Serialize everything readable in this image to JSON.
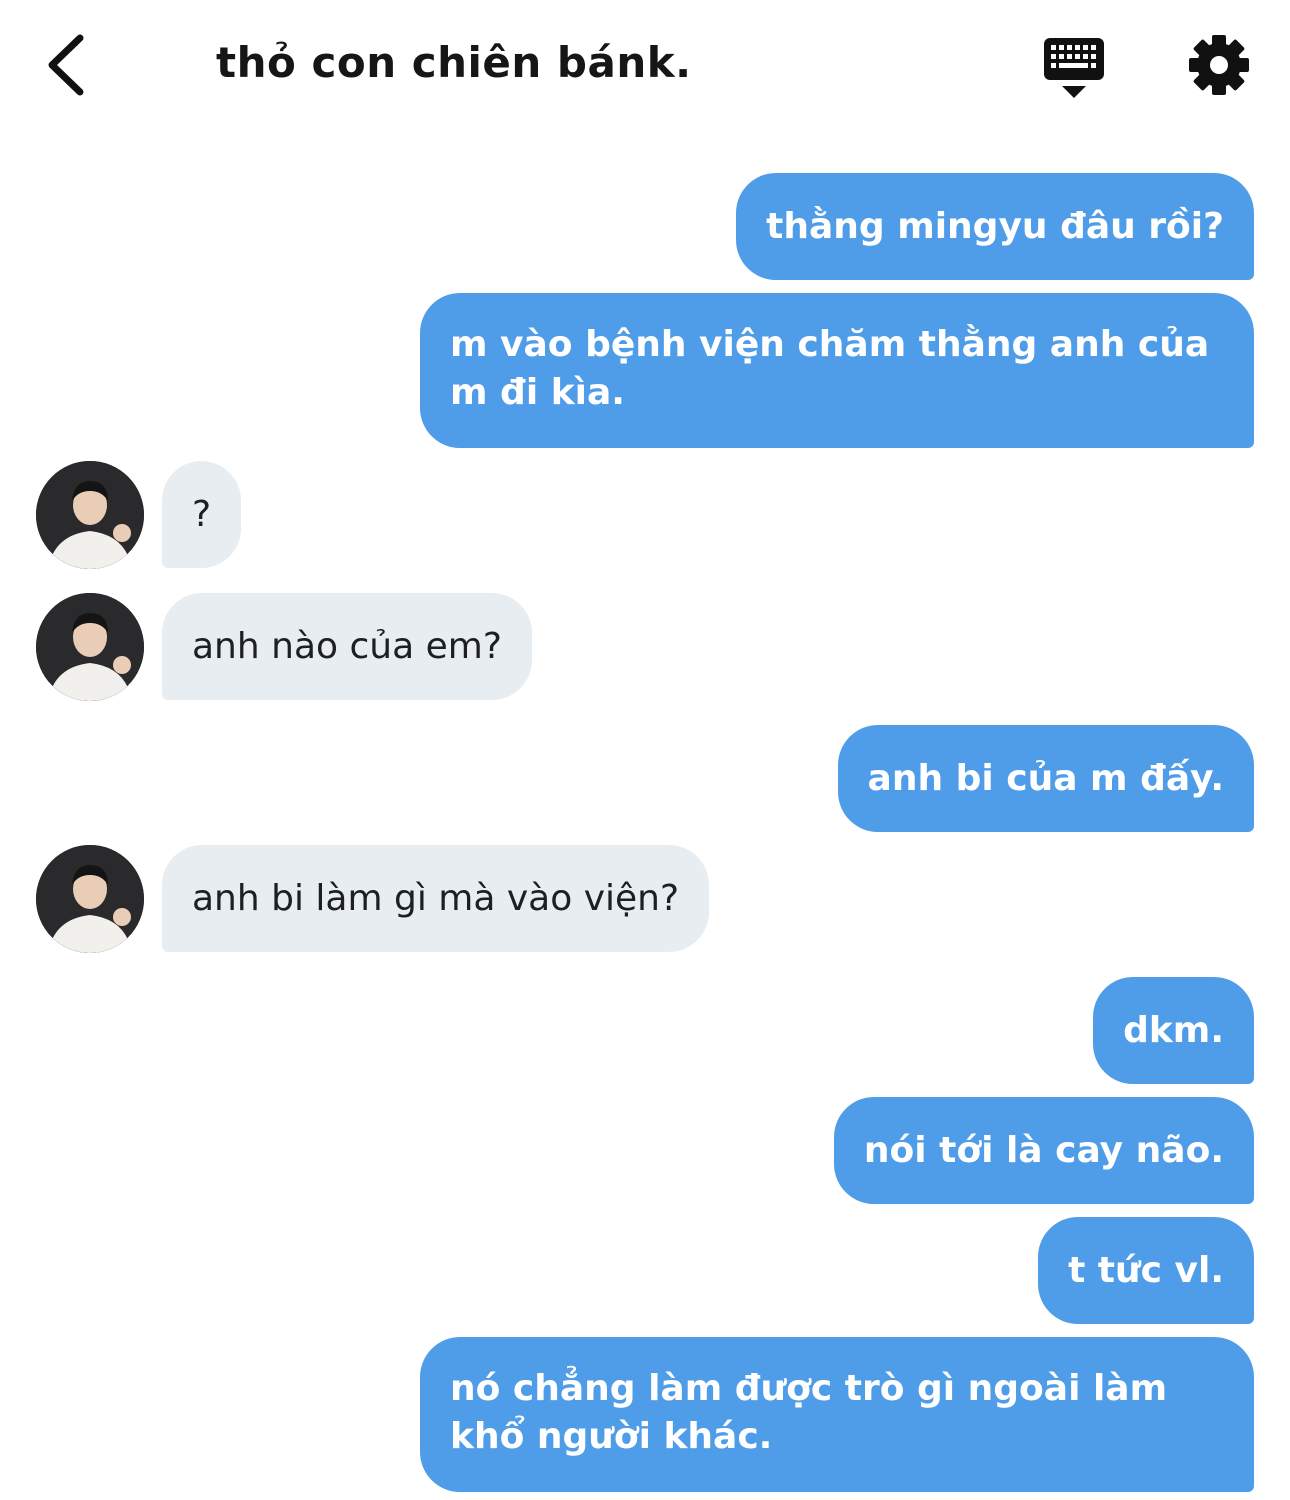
{
  "header": {
    "title": "thỏ con chiên bánk.",
    "icons": {
      "back": "chevron-left-icon",
      "keyboard": "keyboard-icon",
      "settings": "gear-icon"
    }
  },
  "colors": {
    "outgoing_bubble": "#4f9de8",
    "incoming_bubble": "#e8edf2"
  },
  "messages": [
    {
      "side": "out",
      "text": "thằng mingyu đâu rồi?"
    },
    {
      "side": "out",
      "text": "m vào bệnh viện chăm thằng anh của m đi kìa."
    },
    {
      "side": "in",
      "text": "?"
    },
    {
      "side": "in",
      "text": "anh nào của em?"
    },
    {
      "side": "out",
      "text": "anh bi của m đấy."
    },
    {
      "side": "in",
      "text": "anh bi làm gì mà vào viện?"
    },
    {
      "side": "out",
      "text": "dkm."
    },
    {
      "side": "out",
      "text": "nói tới là cay não."
    },
    {
      "side": "out",
      "text": "t tức vl."
    },
    {
      "side": "out",
      "text": "nó chẳng làm được trò gì ngoài làm khổ người khác."
    }
  ]
}
